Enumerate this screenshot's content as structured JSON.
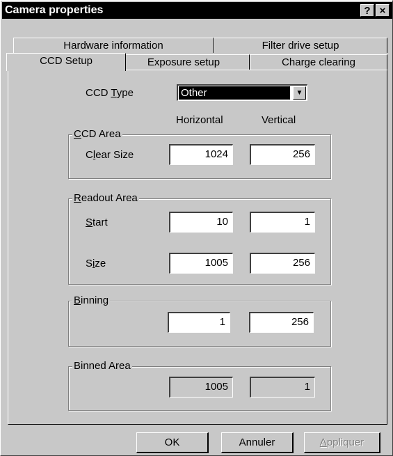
{
  "window": {
    "title": "Camera properties",
    "help_button": "?",
    "close_button": "×"
  },
  "tabs": {
    "back_row": [
      "Hardware information",
      "Filter drive setup"
    ],
    "front_row": [
      "CCD Setup",
      "Exposure setup",
      "Charge clearing"
    ],
    "active": "CCD Setup"
  },
  "ccd_type": {
    "label": "CCD Type",
    "value": "Other"
  },
  "columns": {
    "horizontal": "Horizontal",
    "vertical": "Vertical"
  },
  "ccd_area": {
    "title": "CCD Area",
    "clear_size_label": "Clear Size",
    "clear_size_h": "1024",
    "clear_size_v": "256"
  },
  "readout_area": {
    "title": "Readout Area",
    "start_label": "Start",
    "start_h": "10",
    "start_v": "1",
    "size_label": "Size",
    "size_h": "1005",
    "size_v": "256"
  },
  "binning": {
    "title": "Binning",
    "h": "1",
    "v": "256"
  },
  "binned_area": {
    "title": "Binned Area",
    "h": "1005",
    "v": "1"
  },
  "buttons": {
    "ok": "OK",
    "cancel": "Annuler",
    "apply": "Appliquer"
  }
}
